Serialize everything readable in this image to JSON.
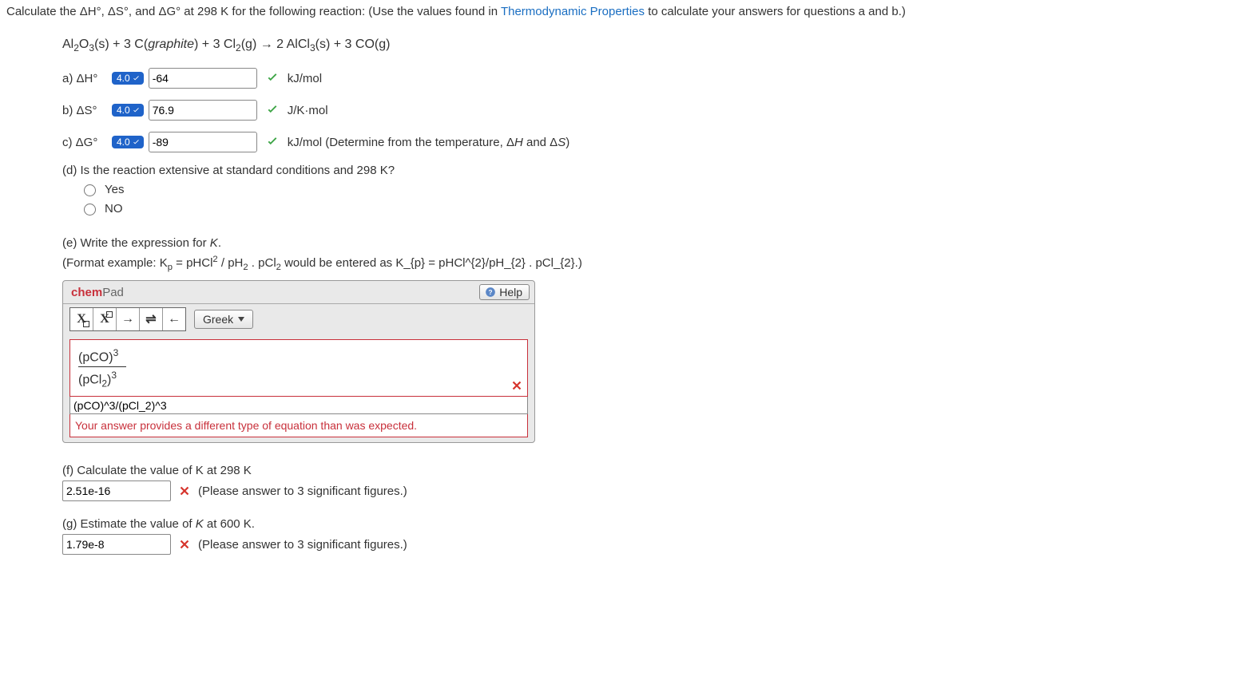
{
  "intro": {
    "pre": "Calculate the ΔH°, ΔS°, and ΔG° at 298 K for the following reaction: (Use the values found in ",
    "link": "Thermodynamic Properties",
    "post": " to calculate your answers for questions a and b.)"
  },
  "equation_html": "Al<sub>2</sub>O<sub>3</sub>(s) + 3 C(<span class='italic'>graphite</span>) + 3 Cl<sub>2</sub>(g) → 2 AlCl<sub>3</sub>(s) + 3 CO(g)",
  "parts": {
    "a": {
      "label": "a) ΔH°",
      "score": "4.0",
      "value": "-64",
      "unit": "kJ/mol",
      "status": "correct"
    },
    "b": {
      "label": "b) ΔS°",
      "score": "4.0",
      "value": "76.9",
      "unit": "J/K·mol",
      "status": "correct"
    },
    "c": {
      "label": "c) ΔG°",
      "score": "4.0",
      "value": "-89",
      "unit_html": "kJ/mol (Determine from the temperature, Δ<span class='italic'>H</span> and Δ<span class='italic'>S</span>)",
      "status": "correct"
    }
  },
  "part_d": {
    "question": "(d) Is the reaction extensive at standard conditions and 298 K?",
    "options": {
      "yes": "Yes",
      "no": "NO"
    }
  },
  "part_e": {
    "prompt_html": "(e) Write the expression for <span class='italic'>K</span>.",
    "format_html": "(Format example: K<sub>p</sub> = pHCl<sup>2</sup> / pH<sub>2</sub> . pCl<sub>2</sub> would be entered as K_{p} = pHCl^{2}/pH_{2} . pCl_{2}.)",
    "chempad": {
      "title_chem": "chem",
      "title_pad": "Pad",
      "help": "Help",
      "greek": "Greek",
      "rendered_top_html": "(pCO)<sup>3</sup>",
      "rendered_bot_html": "(pCl<sub>2</sub>)<sup>3</sup>",
      "raw": "(pCO)^3/(pCl_2)^3",
      "feedback": "Your answer provides a different type of equation than was expected."
    }
  },
  "part_f": {
    "prompt_html": "(f) Calculate the value of K at 298 K",
    "value": "2.51e-16",
    "hint": "(Please answer to 3 significant figures.)",
    "status": "incorrect"
  },
  "part_g": {
    "prompt_html": "(g) Estimate the value of <span class='italic'>K</span> at 600 K.",
    "value": "1.79e-8",
    "hint": "(Please answer to 3 significant figures.)",
    "status": "incorrect"
  }
}
